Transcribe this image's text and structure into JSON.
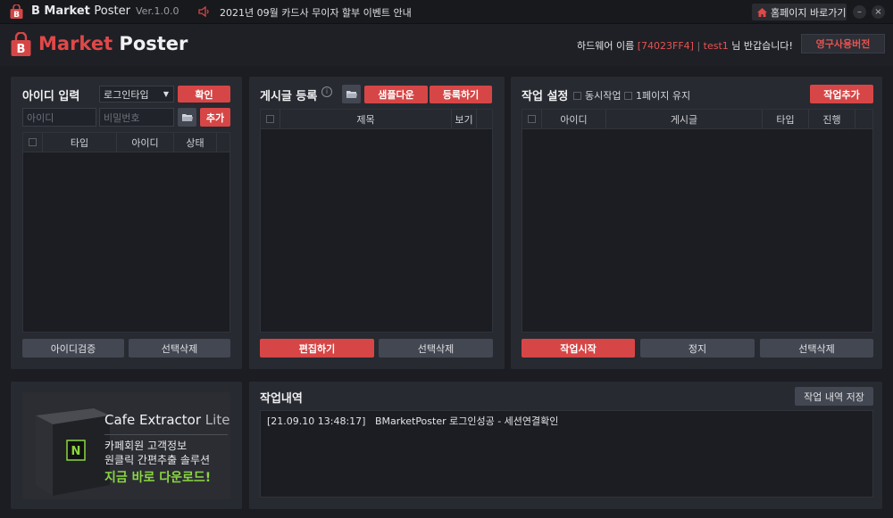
{
  "titlebar": {
    "brand_bold": "B Market",
    "brand_light": "Poster",
    "version": "Ver.1.0.0",
    "notice": "2021년 09월 카드사 무이자 할부 이벤트 안내",
    "home_button": "홈페이지 바로가기",
    "minimize": "–",
    "close": "×"
  },
  "header": {
    "brand_market": "Market",
    "brand_poster": "Poster",
    "hw_label": "하드웨어 이름",
    "hw_id": "[74023FF4]",
    "separator": "|",
    "user": "test1",
    "greeting": "님 반갑습니다!",
    "permanent_button": "영구사용버전"
  },
  "id_panel": {
    "title": "아이디 입력",
    "login_type": "로그인타입",
    "confirm_button": "확인",
    "id_placeholder": "아이디",
    "pw_placeholder": "비밀번호",
    "add_button": "추가",
    "columns": [
      "타입",
      "아이디",
      "상태"
    ],
    "verify_button": "아이디검증",
    "delete_button": "선택삭제"
  },
  "post_panel": {
    "title": "게시글 등록",
    "sample_button": "샘플다운",
    "register_button": "등록하기",
    "columns": [
      "제목",
      "보기"
    ],
    "edit_button": "편집하기",
    "delete_button": "선택삭제"
  },
  "task_panel": {
    "title": "작업 설정",
    "simul_label": "동시작업",
    "keep_label": "1페이지 유지",
    "add_button": "작업추가",
    "columns": [
      "아이디",
      "게시글",
      "타입",
      "진행"
    ],
    "start_button": "작업시작",
    "stop_button": "정지",
    "delete_button": "선택삭제"
  },
  "ad": {
    "product": "Cafe Extractor",
    "product_suffix": "Lite",
    "line1": "카페회원 고객정보",
    "line2": "원클릭 간편추출 솔루션",
    "cta": "지금 바로 다운로드!",
    "box_letter": "N"
  },
  "log_panel": {
    "title": "작업내역",
    "save_button": "작업 내역 저장",
    "entries": [
      "[21.09.10 13:48:17]   BMarketPoster 로그인성공 - 세션연결확인"
    ]
  },
  "colors": {
    "accent": "#d64646",
    "background": "#1b1d22",
    "panel": "#272a31",
    "cta_green": "#8bd641"
  }
}
